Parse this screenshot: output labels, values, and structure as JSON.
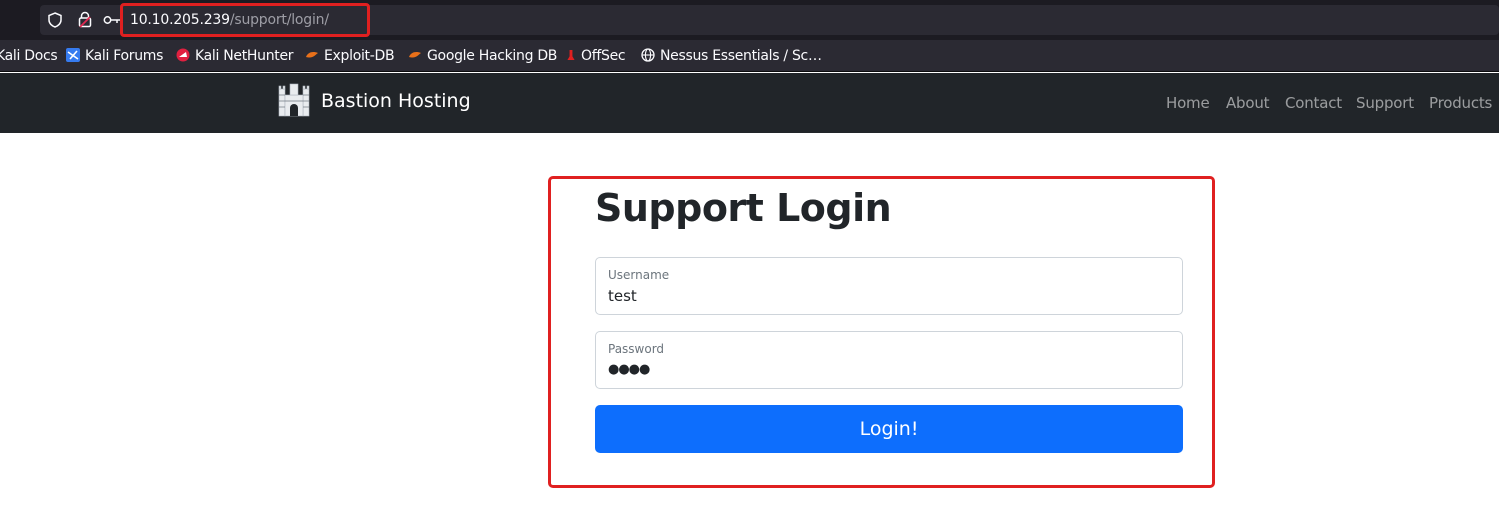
{
  "browser": {
    "url_host": "10.10.205.239",
    "url_path": "/support/login/",
    "icons": [
      "shield-icon",
      "lock-icon",
      "key-icon"
    ]
  },
  "bookmarks": [
    {
      "label": "Kali Docs",
      "icon": "kali-icon"
    },
    {
      "label": "Kali Forums",
      "icon": "kali-forums-icon"
    },
    {
      "label": "Kali NetHunter",
      "icon": "nethunter-icon"
    },
    {
      "label": "Exploit-DB",
      "icon": "exploitdb-icon"
    },
    {
      "label": "Google Hacking DB",
      "icon": "ghdb-icon"
    },
    {
      "label": "OffSec",
      "icon": "offsec-icon"
    },
    {
      "label": "Nessus Essentials / Sc…",
      "icon": "globe-icon"
    }
  ],
  "navbar": {
    "brand": "Bastion Hosting",
    "links": [
      "Home",
      "About",
      "Contact",
      "Support",
      "Products"
    ]
  },
  "login": {
    "title": "Support Login",
    "username_label": "Username",
    "username_value": "test",
    "password_label": "Password",
    "password_value": "●●●●",
    "button_label": "Login!"
  },
  "colors": {
    "highlight": "#e02020",
    "navbar_bg": "#212529",
    "button_bg": "#0d6efd"
  }
}
